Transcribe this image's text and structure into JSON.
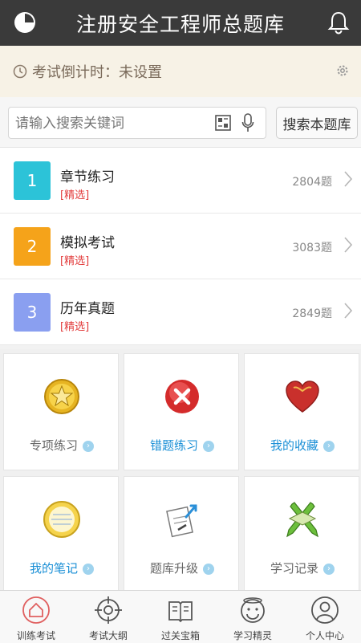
{
  "header": {
    "title": "注册安全工程师总题库"
  },
  "countdown": {
    "label": "考试倒计时：未设置"
  },
  "search": {
    "placeholder": "请输入搜索关键词",
    "button": "搜索本题库"
  },
  "list": [
    {
      "num": "1",
      "name": "章节练习",
      "tag": "[精选]",
      "count": "2804题",
      "color": "#2cc3d8"
    },
    {
      "num": "2",
      "name": "模拟考试",
      "tag": "[精选]",
      "count": "3083题",
      "color": "#f5a31a"
    },
    {
      "num": "3",
      "name": "历年真题",
      "tag": "[精选]",
      "count": "2849题",
      "color": "#8a9ff0"
    }
  ],
  "grid": [
    {
      "label": "专项练习",
      "icon": "star-badge-icon",
      "color": "#666666"
    },
    {
      "label": "错题练习",
      "icon": "red-x-icon",
      "color": "#1a8fd6"
    },
    {
      "label": "我的收藏",
      "icon": "heart-icon",
      "color": "#1a8fd6"
    },
    {
      "label": "我的笔记",
      "icon": "notepad-icon",
      "color": "#1a8fd6"
    },
    {
      "label": "题库升级",
      "icon": "upgrade-doc-icon",
      "color": "#666666"
    },
    {
      "label": "学习记录",
      "icon": "pencil-record-icon",
      "color": "#666666"
    }
  ],
  "tabs": [
    {
      "label": "训练考试",
      "icon": "house-icon",
      "active": true
    },
    {
      "label": "考试大纲",
      "icon": "target-icon"
    },
    {
      "label": "过关宝箱",
      "icon": "book-icon"
    },
    {
      "label": "学习精灵",
      "icon": "smiley-icon"
    },
    {
      "label": "个人中心",
      "icon": "person-icon"
    }
  ]
}
